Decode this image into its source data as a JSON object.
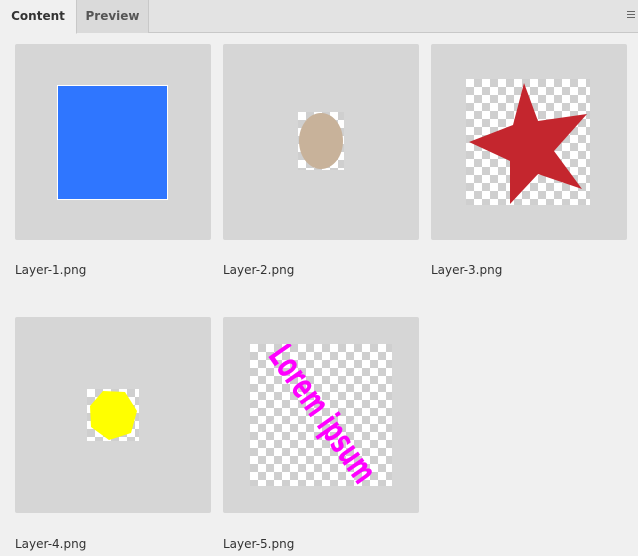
{
  "tabs": [
    {
      "label": "Content",
      "active": true
    },
    {
      "label": "Preview",
      "active": false
    }
  ],
  "panel_menu_icon": "hamburger-menu-icon",
  "layers": [
    {
      "label": "Layer-1.png",
      "shape": "blue-square",
      "color": "#2f76ff"
    },
    {
      "label": "Layer-2.png",
      "shape": "tan-ellipse",
      "color": "#c8b29a"
    },
    {
      "label": "Layer-3.png",
      "shape": "red-star",
      "color": "#c4262e"
    },
    {
      "label": "Layer-4.png",
      "shape": "yellow-hexagon",
      "color": "#ffff00"
    },
    {
      "label": "Layer-5.png",
      "shape": "magenta-text",
      "color": "#ff00ff",
      "text": "Lorem ipsum"
    }
  ]
}
